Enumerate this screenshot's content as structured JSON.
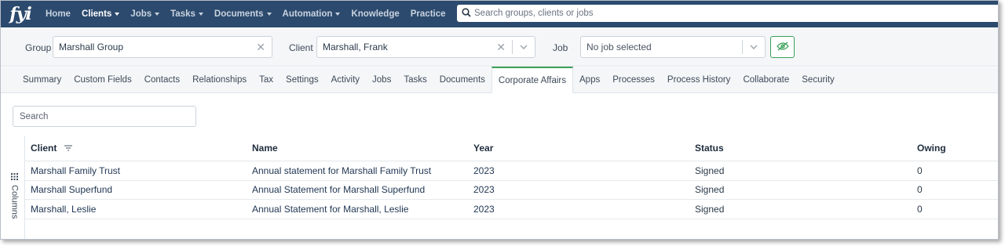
{
  "app": {
    "logo_text": "fyi"
  },
  "topnav": {
    "items": [
      {
        "label": "Home",
        "caret": false,
        "active": false
      },
      {
        "label": "Clients",
        "caret": true,
        "active": true
      },
      {
        "label": "Jobs",
        "caret": true,
        "active": false
      },
      {
        "label": "Tasks",
        "caret": true,
        "active": false
      },
      {
        "label": "Documents",
        "caret": true,
        "active": false
      },
      {
        "label": "Automation",
        "caret": true,
        "active": false
      },
      {
        "label": "Knowledge",
        "caret": false,
        "active": false
      },
      {
        "label": "Practice",
        "caret": false,
        "active": false
      }
    ],
    "search_placeholder": "Search groups, clients or jobs"
  },
  "selectors": {
    "group_label": "Group",
    "group_value": "Marshall Group",
    "client_label": "Client",
    "client_value": "Marshall, Frank",
    "job_label": "Job",
    "job_value": "No job selected"
  },
  "tabs": [
    "Summary",
    "Custom Fields",
    "Contacts",
    "Relationships",
    "Tax",
    "Settings",
    "Activity",
    "Jobs",
    "Tasks",
    "Documents",
    "Corporate Affairs",
    "Apps",
    "Processes",
    "Process History",
    "Collaborate",
    "Security"
  ],
  "active_tab": "Corporate Affairs",
  "content": {
    "search_placeholder": "Search",
    "columns_label": "Columns",
    "headers": {
      "client": "Client",
      "name": "Name",
      "year": "Year",
      "status": "Status",
      "owing": "Owing"
    },
    "rows": [
      {
        "client": "Marshall Family Trust",
        "name": "Annual statement for Marshall Family Trust",
        "year": "2023",
        "status": "Signed",
        "owing": "0"
      },
      {
        "client": "Marshall Superfund",
        "name": "Annual Statement for Marshall Superfund",
        "year": "2023",
        "status": "Signed",
        "owing": "0"
      },
      {
        "client": "Marshall, Leslie",
        "name": "Annual Statement for Marshall, Leslie",
        "year": "2023",
        "status": "Signed",
        "owing": "0"
      }
    ]
  },
  "colors": {
    "nav_bg": "#2c4a6e",
    "accent_green": "#3aa05a",
    "link_blue": "#1f3552"
  }
}
